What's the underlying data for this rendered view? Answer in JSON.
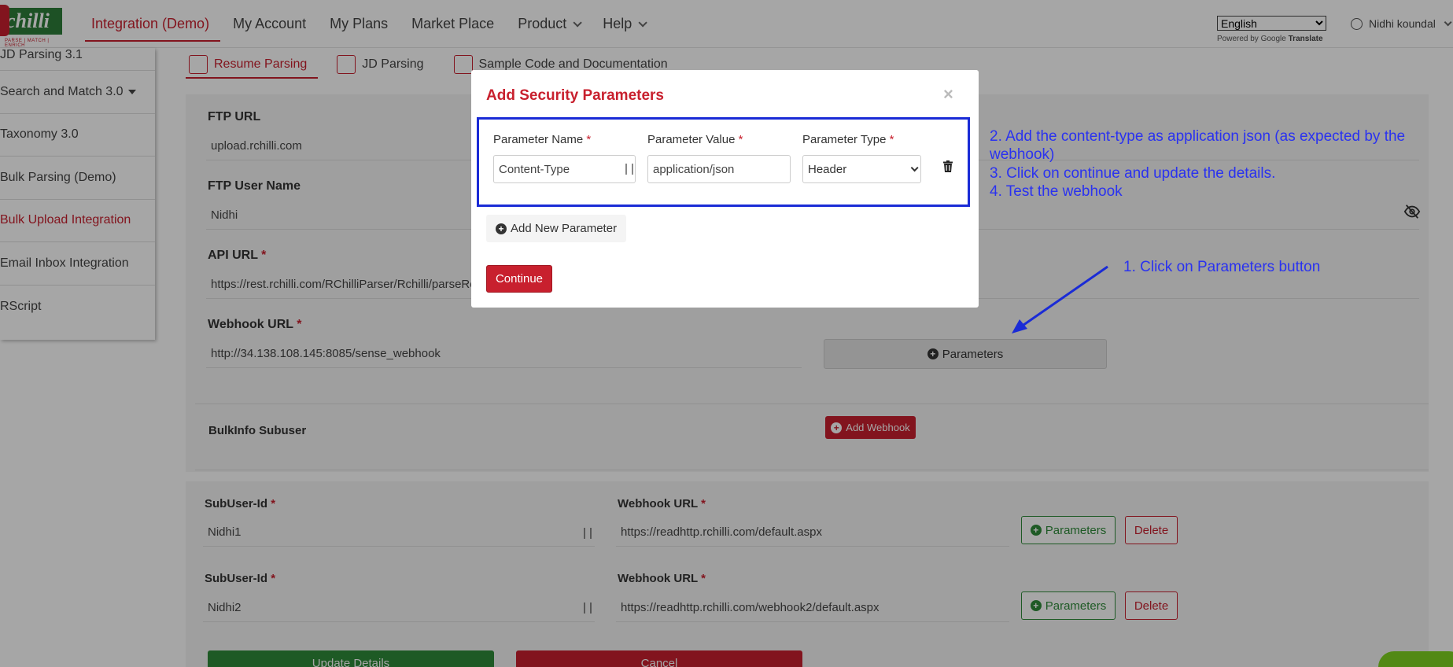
{
  "brand": {
    "logo_text": "chilli",
    "tagline": "PARSE | MATCH | ENRICH"
  },
  "nav": {
    "items": [
      {
        "label": "Integration (Demo)",
        "active": true
      },
      {
        "label": "My Account"
      },
      {
        "label": "My Plans"
      },
      {
        "label": "Market Place"
      },
      {
        "label": "Product",
        "dropdown": true
      },
      {
        "label": "Help",
        "dropdown": true
      }
    ]
  },
  "translate": {
    "language": "English",
    "powered_prefix": "Powered by",
    "google": "Google",
    "translate": "Translate"
  },
  "user": {
    "name": "Nidhi koundal"
  },
  "sidebar": {
    "items": [
      {
        "label": "JD Parsing 3.1"
      },
      {
        "label": "Search and Match 3.0",
        "caret": true
      },
      {
        "label": "Taxonomy 3.0"
      },
      {
        "label": "Bulk Parsing (Demo)"
      },
      {
        "label": "Bulk Upload Integration",
        "active": true
      },
      {
        "label": "Email Inbox Integration"
      },
      {
        "label": "RScript"
      }
    ]
  },
  "subtabs": [
    {
      "label": "Resume Parsing",
      "active": true
    },
    {
      "label": "JD Parsing"
    },
    {
      "label": "Sample Code and Documentation"
    }
  ],
  "form": {
    "ftp_url": {
      "label": "FTP URL",
      "value": "upload.rchilli.com"
    },
    "ftp_user": {
      "label": "FTP User Name",
      "value": "Nidhi"
    },
    "api_url": {
      "label": "API URL",
      "value": "https://rest.rchilli.com/RChilliParser/Rchilli/parseResume"
    },
    "webhook_url": {
      "label": "Webhook URL",
      "value": "http://34.138.108.145:8085/sense_webhook"
    },
    "parameters_button": "Parameters",
    "bulkinfo_label": "BulkInfo Subuser",
    "add_webhook": "Add Webhook",
    "required_mark": "*"
  },
  "subusers": [
    {
      "id_label": "SubUser-Id",
      "id_value": "Nidhi1",
      "url_label": "Webhook URL",
      "url_value": "https://readhttp.rchilli.com/default.aspx",
      "params": "Parameters",
      "delete": "Delete"
    },
    {
      "id_label": "SubUser-Id",
      "id_value": "Nidhi2",
      "url_label": "Webhook URL",
      "url_value": "https://readhttp.rchilli.com/webhook2/default.aspx",
      "params": "Parameters",
      "delete": "Delete"
    }
  ],
  "footer_buttons": {
    "update": "Update Details",
    "cancel": "Cancel"
  },
  "modal": {
    "title": "Add Security Parameters",
    "close": "×",
    "param_name_label": "Parameter Name",
    "param_value_label": "Parameter Value",
    "param_type_label": "Parameter Type",
    "param_name": "Content-Type",
    "param_value": "application/json",
    "param_type": "Header",
    "add_new": "Add New Parameter",
    "continue": "Continue"
  },
  "annotations": {
    "step1": "1. Click on Parameters button",
    "step2": "2. Add the content-type as application json (as expected by the webhook)",
    "step3": "3. Click on continue and update the details.",
    "step4": "4. Test the webhook"
  },
  "colors": {
    "brand_red": "#c8202e",
    "brand_green": "#2e8b3a",
    "annotation_blue": "#2a32f0",
    "highlight_blue": "#1a2bd6"
  }
}
